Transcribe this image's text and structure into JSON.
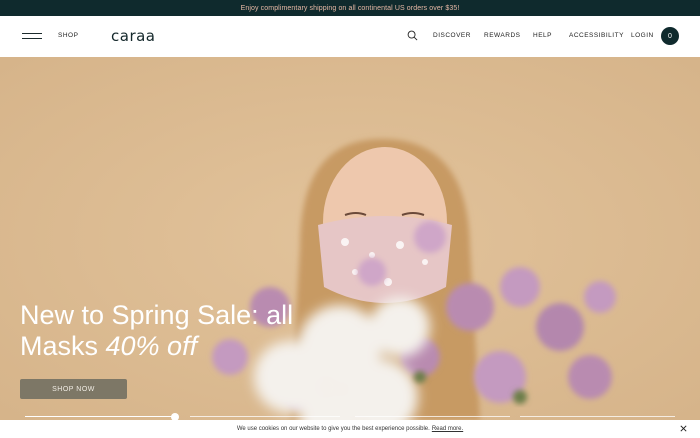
{
  "promo": {
    "text": "Enjoy complimentary shipping on all continental US orders over $35!"
  },
  "nav": {
    "shop": "SHOP",
    "logo": "caraa",
    "links": [
      "DISCOVER",
      "REWARDS",
      "HELP",
      "ACCESSIBILITY",
      "LOGIN"
    ],
    "cart_count": "0"
  },
  "hero": {
    "headline_line1": "New to Spring Sale: all",
    "headline_line2_a": "Masks ",
    "headline_line2_b": "40% off",
    "cta": "SHOP NOW",
    "slide_progress": 0.9,
    "slide_count": 4,
    "active_slide": 1
  },
  "cookie": {
    "text": "We use cookies on our website to give you the best experience possible.",
    "link": "Read more."
  },
  "colors": {
    "promo_bg": "#0f2a2d",
    "promo_text": "#e7b9a6",
    "hero_bg": "#dcbb92",
    "cta_bg": "#7d7766"
  }
}
